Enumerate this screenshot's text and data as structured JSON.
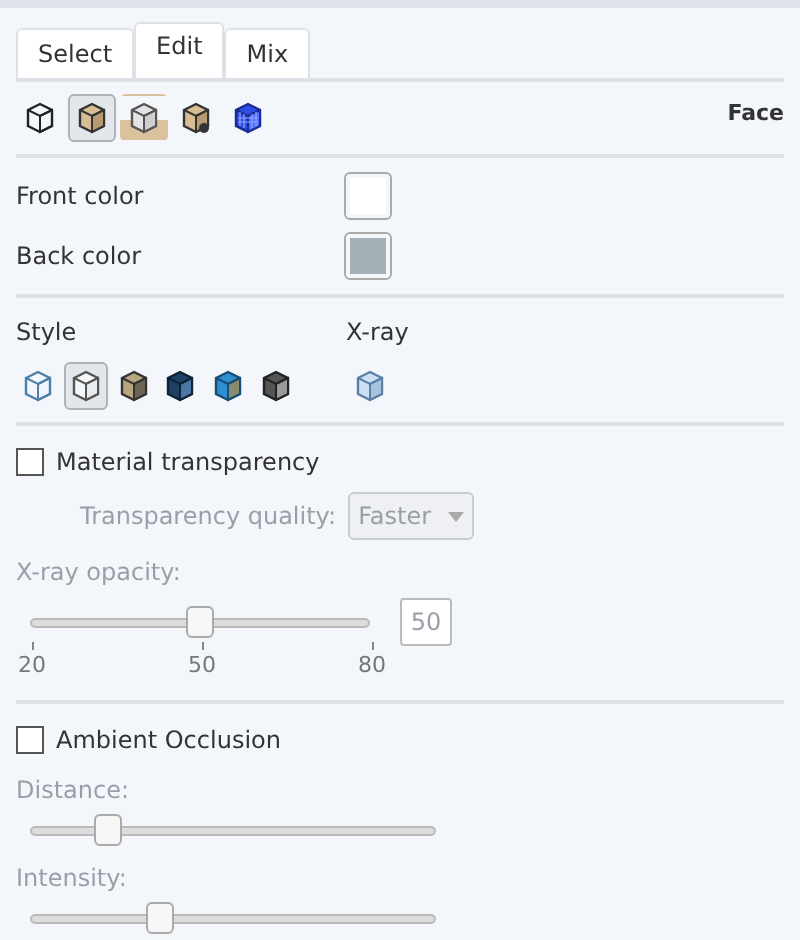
{
  "tabs": [
    {
      "label": "Select",
      "selected": false
    },
    {
      "label": "Edit",
      "selected": true
    },
    {
      "label": "Mix",
      "selected": false
    }
  ],
  "modes": {
    "items": [
      {
        "kind": "wireframe",
        "selected": false,
        "highlighted": false
      },
      {
        "kind": "solid",
        "selected": true,
        "highlighted": false
      },
      {
        "kind": "plain",
        "selected": false,
        "highlighted": true
      },
      {
        "kind": "marked",
        "selected": false,
        "highlighted": false
      },
      {
        "kind": "mesh",
        "selected": false,
        "highlighted": false
      }
    ],
    "label": "Face"
  },
  "colors": [
    {
      "label": "Front color",
      "color": "#ffffff"
    },
    {
      "label": "Back color",
      "color": "#a4afb6"
    }
  ],
  "style": {
    "label": "Style",
    "items": [
      {
        "kind": "wire",
        "selected": false
      },
      {
        "kind": "outline",
        "selected": true
      },
      {
        "kind": "shaded",
        "selected": false
      },
      {
        "kind": "banded",
        "selected": false
      },
      {
        "kind": "split",
        "selected": false
      },
      {
        "kind": "dark",
        "selected": false
      }
    ]
  },
  "xray": {
    "label": "X-ray",
    "items": [
      {
        "kind": "glass",
        "selected": false
      }
    ]
  },
  "material_transparency": {
    "label": "Material transparency",
    "checked": false
  },
  "transparency_quality": {
    "label": "Transparency quality:",
    "value": "Faster",
    "disabled": true
  },
  "xray_opacity": {
    "label": "X-ray opacity:",
    "level": 0.5,
    "value": "50",
    "ticks": [
      "20",
      "50",
      "80"
    ],
    "disabled": true
  },
  "ambient_occlusion": {
    "label": "Ambient Occlusion",
    "checked": false
  },
  "sliders": [
    {
      "label": "Distance:",
      "level": 0.19,
      "disabled": true
    },
    {
      "label": "Intensity:",
      "level": 0.32,
      "disabled": true
    }
  ]
}
